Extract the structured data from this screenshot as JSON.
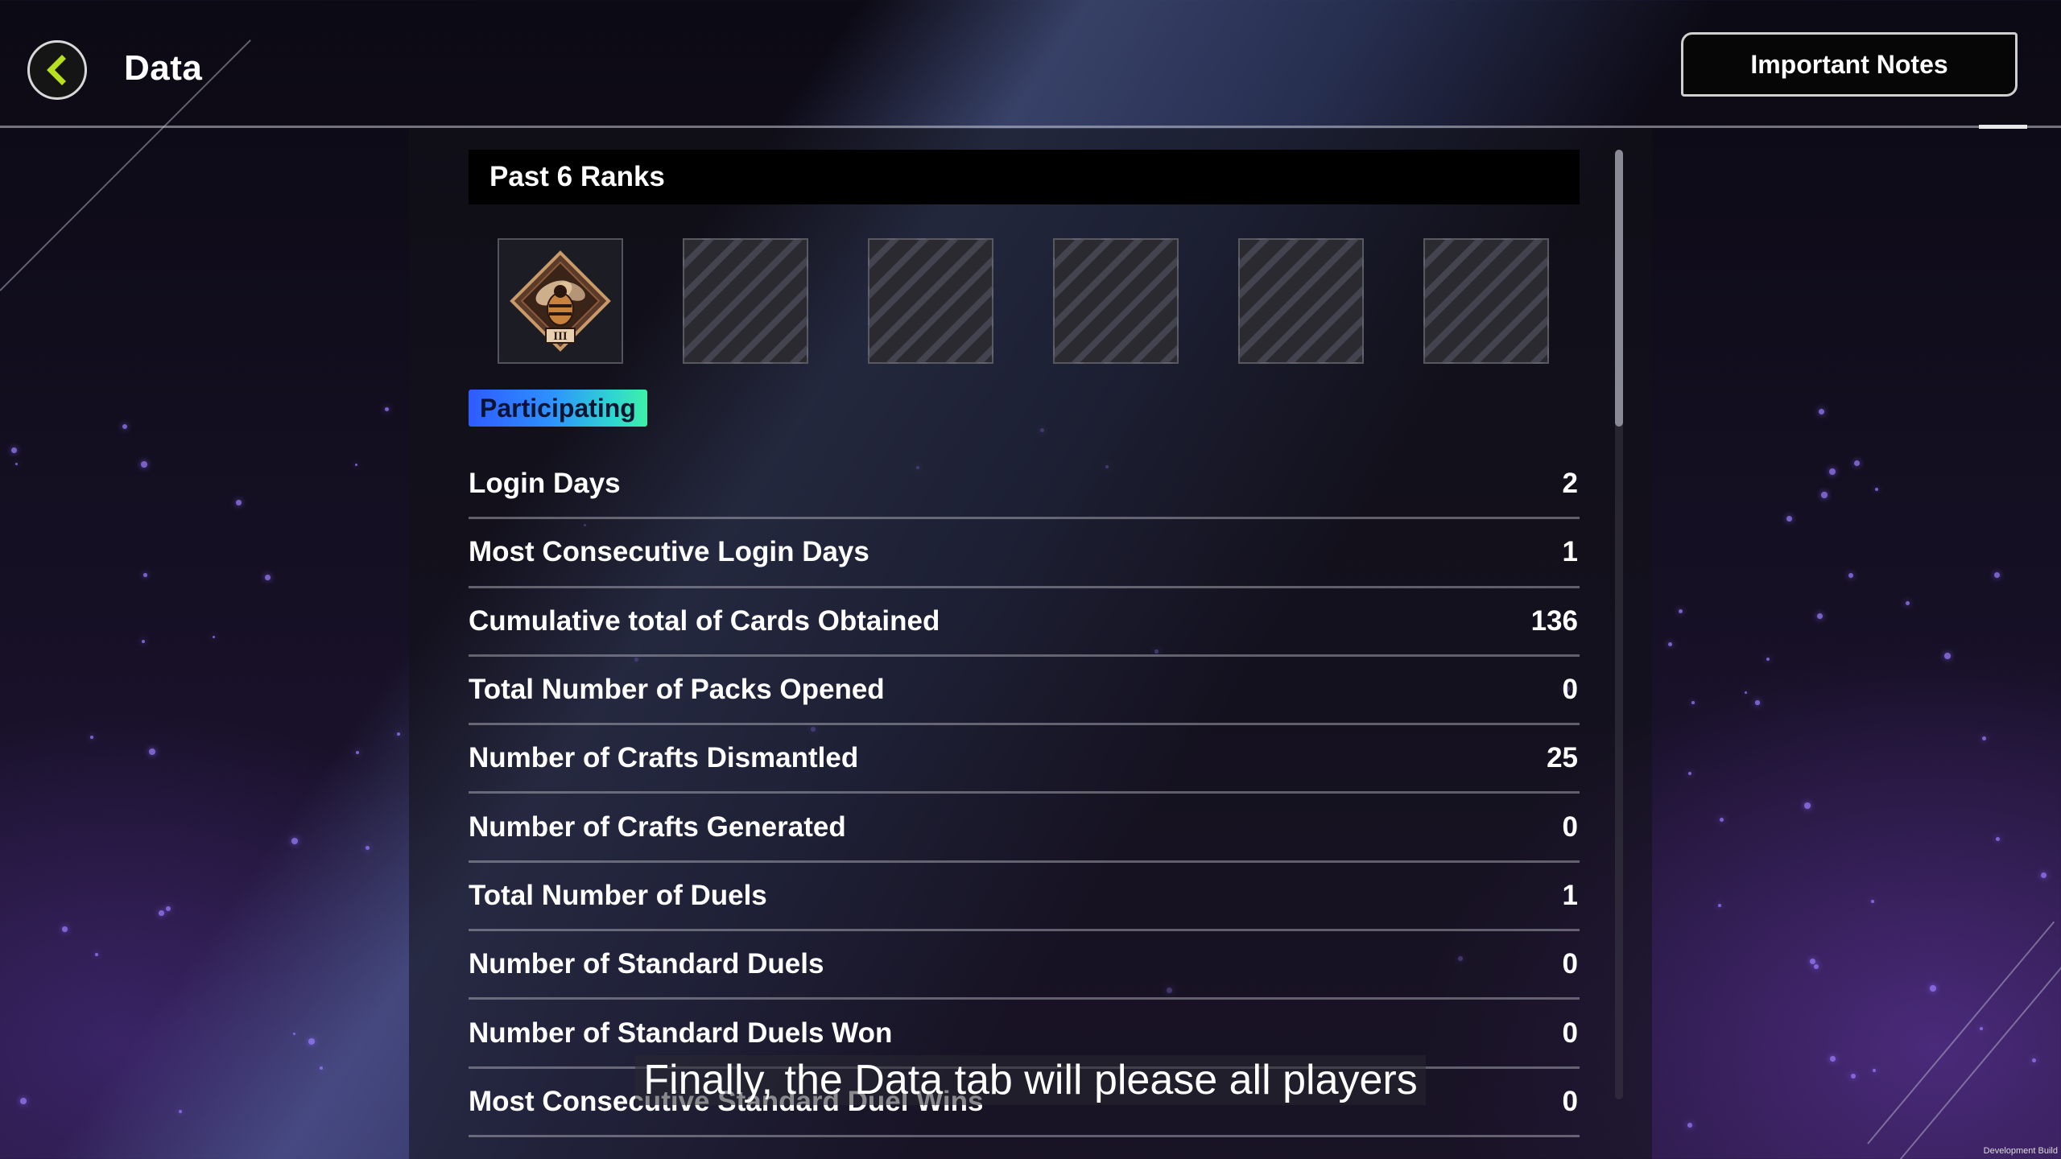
{
  "header": {
    "title": "Data",
    "back_icon": "chevron-left-icon",
    "important_notes_label": "Important Notes"
  },
  "ranks": {
    "title": "Past 6 Ranks",
    "slots": [
      {
        "state": "filled",
        "icon": "bee-rank-emblem-icon",
        "tier": "III"
      },
      {
        "state": "empty"
      },
      {
        "state": "empty"
      },
      {
        "state": "empty"
      },
      {
        "state": "empty"
      },
      {
        "state": "empty"
      }
    ],
    "status": "Participating"
  },
  "stats": [
    {
      "label": "Login Days",
      "value": "2"
    },
    {
      "label": "Most Consecutive Login Days",
      "value": "1"
    },
    {
      "label": "Cumulative total of Cards Obtained",
      "value": "136"
    },
    {
      "label": "Total Number of Packs Opened",
      "value": "0"
    },
    {
      "label": "Number of Crafts Dismantled",
      "value": "25"
    },
    {
      "label": "Number of Crafts Generated",
      "value": "0"
    },
    {
      "label": "Total Number of Duels",
      "value": "1"
    },
    {
      "label": "Number of Standard Duels",
      "value": "0"
    },
    {
      "label": "Number of Standard Duels Won",
      "value": "0"
    },
    {
      "label": "Most Consecutive Standard Duel Wins",
      "value": "0"
    }
  ],
  "subtitle": "Finally, the Data tab will please all players",
  "footer": {
    "build_label": "Development Build"
  },
  "colors": {
    "accent_back": "#b6e020",
    "badge_gradient_start": "#2f5bff",
    "badge_gradient_end": "#3ef0a8"
  }
}
